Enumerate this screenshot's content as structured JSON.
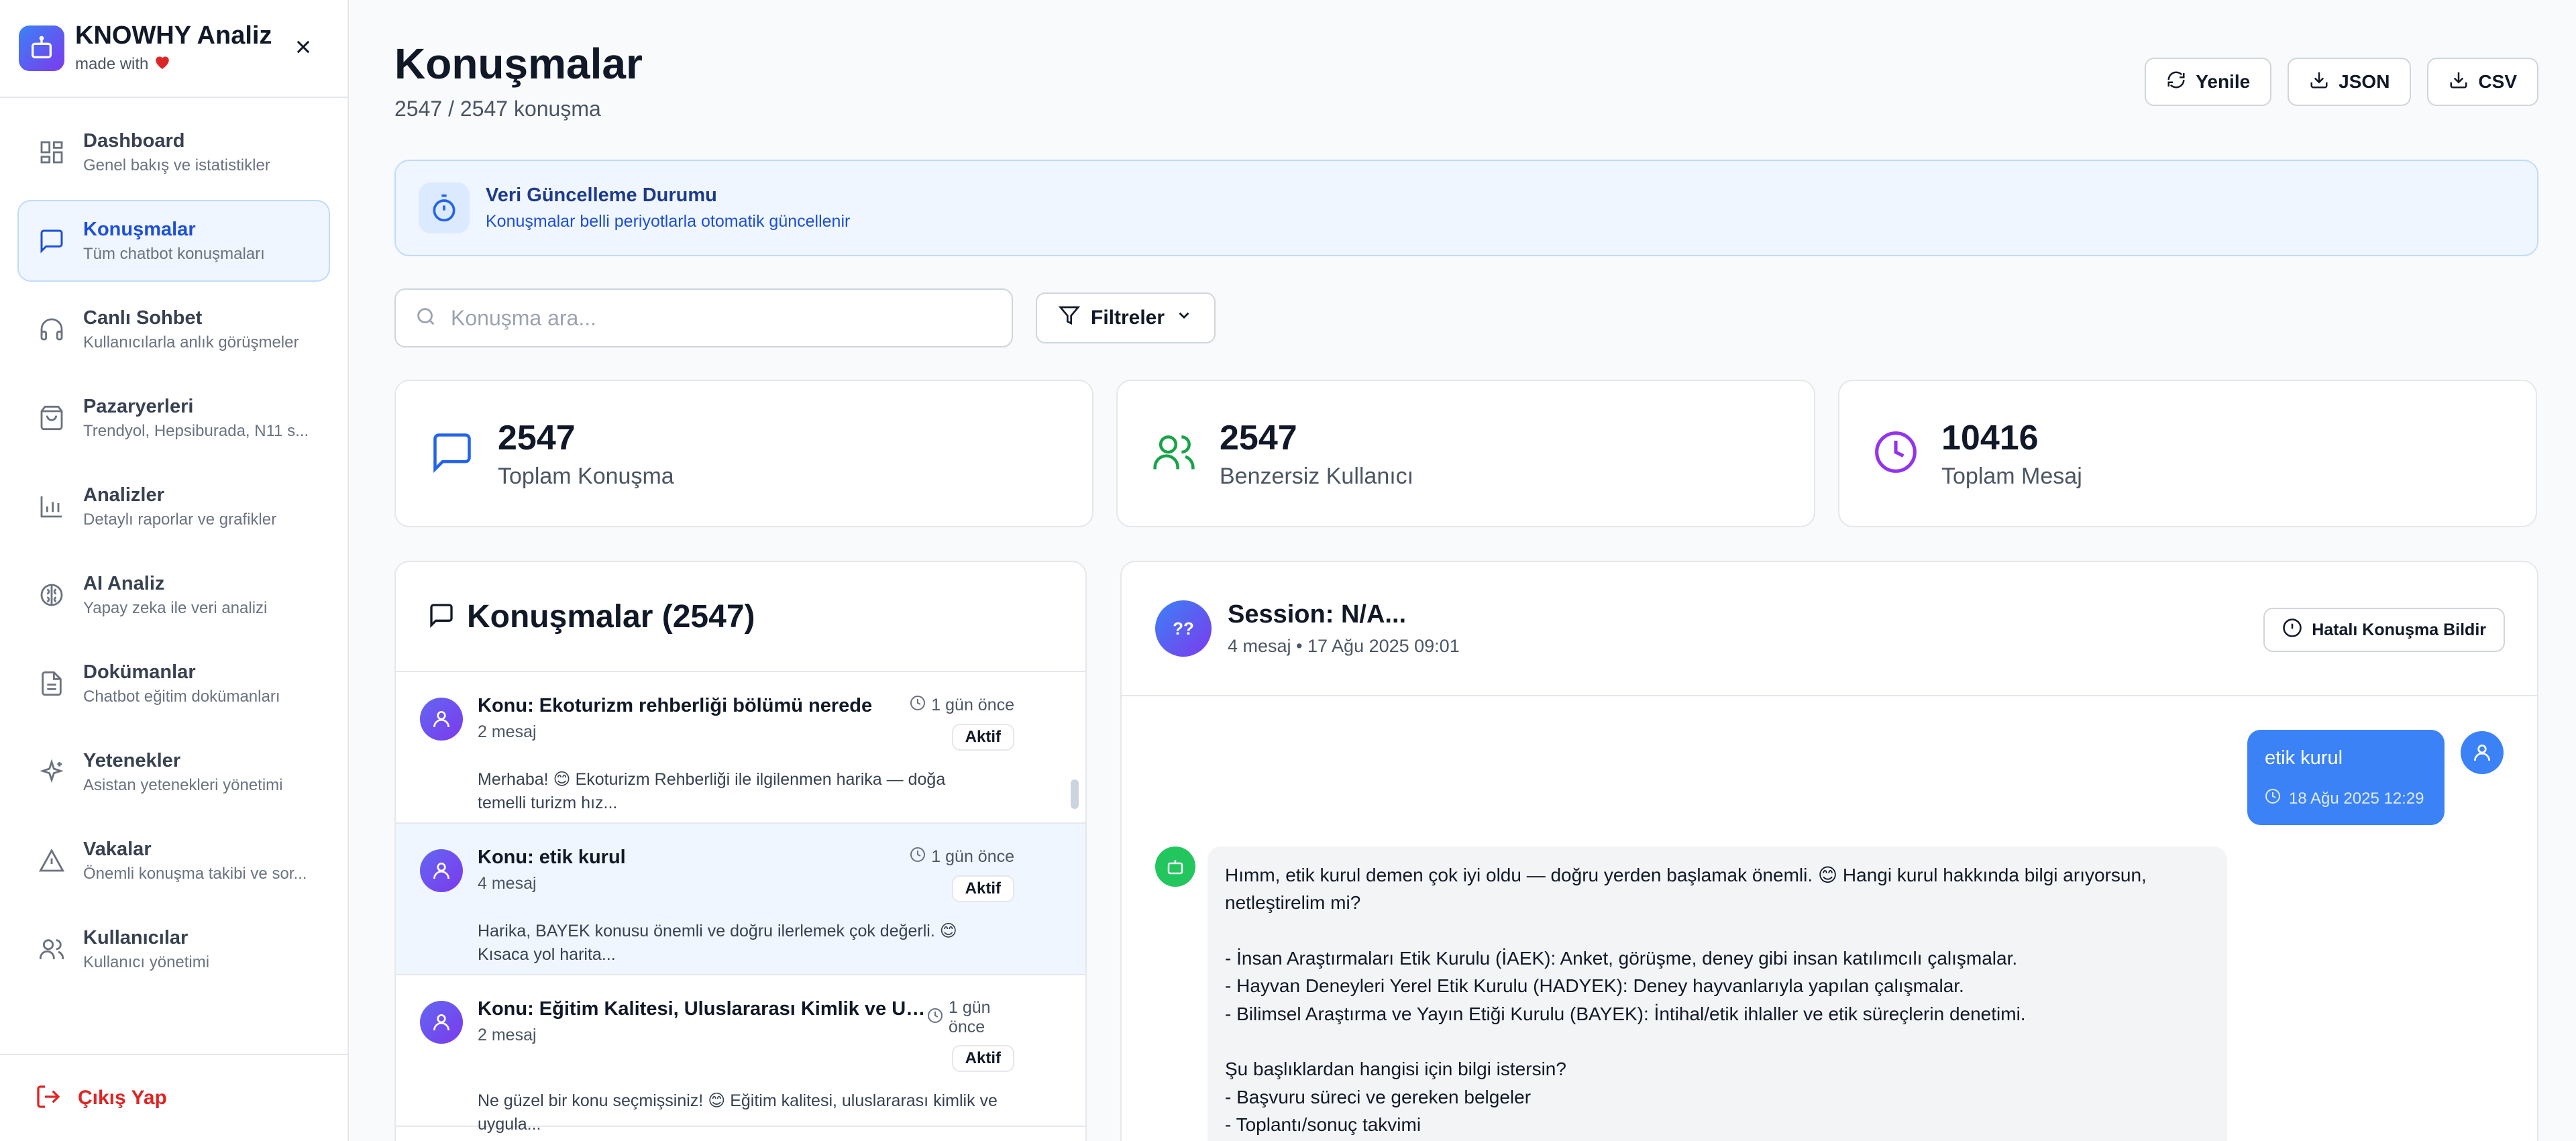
{
  "brand": {
    "title": "KNOWHY Analiz",
    "made_with": "made with"
  },
  "sidebar": {
    "items": [
      {
        "label": "Dashboard",
        "desc": "Genel bakış ve istatistikler",
        "icon": "dashboard-grid-icon"
      },
      {
        "label": "Konuşmalar",
        "desc": "Tüm chatbot konuşmaları",
        "icon": "message-square-icon",
        "active": true
      },
      {
        "label": "Canlı Sohbet",
        "desc": "Kullanıcılarla anlık görüşmeler",
        "icon": "headphones-icon"
      },
      {
        "label": "Pazaryerleri",
        "desc": "Trendyol, Hepsiburada, N11 s...",
        "icon": "shopping-bag-icon"
      },
      {
        "label": "Analizler",
        "desc": "Detaylı raporlar ve grafikler",
        "icon": "bar-chart-icon"
      },
      {
        "label": "AI Analiz",
        "desc": "Yapay zeka ile veri analizi",
        "icon": "brain-icon"
      },
      {
        "label": "Dokümanlar",
        "desc": "Chatbot eğitim dokümanları",
        "icon": "file-text-icon"
      },
      {
        "label": "Yetenekler",
        "desc": "Asistan yetenekleri yönetimi",
        "icon": "sparkles-icon"
      },
      {
        "label": "Vakalar",
        "desc": "Önemli konuşma takibi ve sor...",
        "icon": "alert-triangle-icon"
      },
      {
        "label": "Kullanıcılar",
        "desc": "Kullanıcı yönetimi",
        "icon": "users-icon"
      }
    ],
    "logout": "Çıkış Yap"
  },
  "page": {
    "title": "Konuşmalar",
    "subtitle": "2547 / 2547 konuşma"
  },
  "actions": {
    "refresh": "Yenile",
    "json": "JSON",
    "csv": "CSV"
  },
  "notice": {
    "title": "Veri Güncelleme Durumu",
    "desc": "Konuşmalar belli periyotlarla otomatik güncellenir"
  },
  "search": {
    "placeholder": "Konuşma ara..."
  },
  "filters": {
    "label": "Filtreler"
  },
  "stats": [
    {
      "value": "2547",
      "label": "Toplam Konuşma",
      "color": "#2563eb"
    },
    {
      "value": "2547",
      "label": "Benzersiz Kullanıcı",
      "color": "#16a34a"
    },
    {
      "value": "10416",
      "label": "Toplam Mesaj",
      "color": "#9333ea"
    }
  ],
  "list": {
    "title": "Konuşmalar (2547)",
    "items": [
      {
        "title": "Konu: Ekoturizm rehberliği bölümü nerede",
        "count": "2 mesaj",
        "time": "1 gün önce",
        "badge": "Aktif",
        "preview_a": "Merhaba! 😊 Ekoturizm Rehberliği ile ilgilenmen harika — doğa",
        "preview_b": "temelli turizm hız..."
      },
      {
        "title": "Konu: etik kurul",
        "count": "4 mesaj",
        "time": "1 gün önce",
        "badge": "Aktif",
        "preview_a": "Harika, BAYEK konusu önemli ve doğru ilerlemek çok değerli. 😊",
        "preview_b": "Kısaca yol harita..."
      },
      {
        "title": "Konu: Eğitim Kalitesi, Uluslararası Kimlik ve Uygul...",
        "count": "2 mesaj",
        "time": "1 gün önce",
        "badge": "Aktif",
        "preview_a": "Ne güzel bir konu seçmişsiniz! 😊 Eğitim kalitesi, uluslararası kimlik ve",
        "preview_b": "uygula..."
      }
    ]
  },
  "chat": {
    "session_avatar": "??",
    "session_title": "Session: N/A...",
    "session_meta": "4 mesaj • 17 Ağu 2025 09:01",
    "report": "Hatalı Konuşma Bildir",
    "user_msg": "etik kurul",
    "user_time": "18 Ağu 2025 12:29",
    "bot_lines": [
      "Hımm, etik kurul demen çok iyi oldu — doğru yerden başlamak önemli. 😊 Hangi kurul hakkında bilgi arıyorsun,",
      "netleştirelim mi?",
      "",
      "- İnsan Araştırmaları Etik Kurulu (İAEK): Anket, görüşme, deney gibi insan katılımcılı çalışmalar.",
      "- Hayvan Deneyleri Yerel Etik Kurulu (HADYEK): Deney hayvanlarıyla yapılan çalışmalar.",
      "- Bilimsel Araştırma ve Yayın Etiği Kurulu (BAYEK): İntihal/etik ihlaller ve etik süreçlerin denetimi.",
      "",
      "Şu başlıklardan hangisi için bilgi istersin?",
      "- Başvuru süreci ve gereken belgeler",
      "- Toplantı/sonuç takvimi"
    ]
  }
}
